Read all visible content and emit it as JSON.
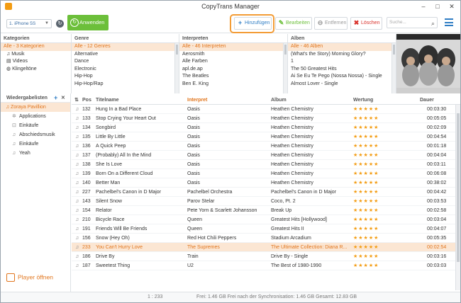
{
  "window": {
    "title": "CopyTrans Manager",
    "min": "–",
    "max": "□",
    "close": "✕"
  },
  "toolbar": {
    "device": "1. iPhone 5S",
    "refresh_icon": "↻",
    "apply_label": "Anwenden",
    "add_label": "Hinzufügen",
    "edit_label": "Bearbeiten",
    "remove_label": "Entfernen",
    "delete_label": "Löschen",
    "search_placeholder": "Suche..."
  },
  "panes": {
    "categories": {
      "header": "Kategorien",
      "items": [
        "Alle - 3 Kategorien",
        "Musik",
        "Videos",
        "Klingeltöne"
      ]
    },
    "genre": {
      "header": "Genre",
      "items": [
        "Alle - 12 Genres",
        "Alternative",
        "Dance",
        "Electronic",
        "Hip-Hop",
        "Hip-Hop/Rap"
      ]
    },
    "artist": {
      "header": "Interpreten",
      "items": [
        "Alle - 46 Interpreten",
        "Aerosmith",
        "Alle Farben",
        "apl.de.ap",
        "The Beatles",
        "Ben E. King"
      ]
    },
    "album": {
      "header": "Alben",
      "items": [
        "Alle - 46 Alben",
        "(What's the Story) Morning Glory?",
        "1",
        "The 50 Greatest Hits",
        "Ai Se Eu Te Pego (Nossa Nossa) - Single",
        "Almost Lover - Single"
      ]
    }
  },
  "playlists": {
    "header": "Wiedergabelisten",
    "add_icon": "+",
    "remove_icon": "✕",
    "items": [
      "Zoraya Pavillion",
      "Applications",
      "Einkäufe",
      "Abschiedsmusik",
      "Einkäufe",
      "Yeah"
    ]
  },
  "player_open": "Player öffnen",
  "table": {
    "columns": {
      "pos": "Pos",
      "title": "Titelname",
      "artist": "Interpret",
      "album": "Album",
      "rating": "Wertung",
      "duration": "Dauer"
    },
    "rows": [
      {
        "pos": "132",
        "title": "Hung In a Bad Place",
        "artist": "Oasis",
        "album": "Heathen Chemistry",
        "rating": "★★★★★",
        "duration": "00:03:30"
      },
      {
        "pos": "133",
        "title": "Stop Crying Your Heart Out",
        "artist": "Oasis",
        "album": "Heathen Chemistry",
        "rating": "★★★★★",
        "duration": "00:05:05"
      },
      {
        "pos": "134",
        "title": "Songbird",
        "artist": "Oasis",
        "album": "Heathen Chemistry",
        "rating": "★★★★★",
        "duration": "00:02:09"
      },
      {
        "pos": "135",
        "title": "Little By Little",
        "artist": "Oasis",
        "album": "Heathen Chemistry",
        "rating": "★★★★★",
        "duration": "00:04:54"
      },
      {
        "pos": "136",
        "title": "A Quick Peep",
        "artist": "Oasis",
        "album": "Heathen Chemistry",
        "rating": "★★★★★",
        "duration": "00:01:18"
      },
      {
        "pos": "137",
        "title": "(Probably) All In the Mind",
        "artist": "Oasis",
        "album": "Heathen Chemistry",
        "rating": "★★★★★",
        "duration": "00:04:04"
      },
      {
        "pos": "138",
        "title": "She Is Love",
        "artist": "Oasis",
        "album": "Heathen Chemistry",
        "rating": "★★★★★",
        "duration": "00:03:11"
      },
      {
        "pos": "139",
        "title": "Born On a Different Cloud",
        "artist": "Oasis",
        "album": "Heathen Chemistry",
        "rating": "★★★★★",
        "duration": "00:06:08"
      },
      {
        "pos": "140",
        "title": "Better Man",
        "artist": "Oasis",
        "album": "Heathen Chemistry",
        "rating": "★★★★★",
        "duration": "00:38:02"
      },
      {
        "pos": "227",
        "title": "Pachelbel's Canon in D Major",
        "artist": "Pachelbel Orchestra",
        "album": "Pachelbel's Canon in D Major",
        "rating": "★★★★★",
        "duration": "00:04:42"
      },
      {
        "pos": "143",
        "title": "Silent Snow",
        "artist": "Parov Stelar",
        "album": "Coco, Pt. 2",
        "rating": "★★★★★",
        "duration": "00:03:53"
      },
      {
        "pos": "154",
        "title": "Relator",
        "artist": "Pete Yorn & Scarlett Johansson",
        "album": "Break Up",
        "rating": "★★★★★",
        "duration": "00:02:58"
      },
      {
        "pos": "210",
        "title": "Bicycle Race",
        "artist": "Queen",
        "album": "Greatest Hits [Hollywood]",
        "rating": "★★★★★",
        "duration": "00:03:04"
      },
      {
        "pos": "191",
        "title": "Friends Will Be Friends",
        "artist": "Queen",
        "album": "Greatest Hits II",
        "rating": "★★★★★",
        "duration": "00:04:07"
      },
      {
        "pos": "156",
        "title": "Snow (Hey Oh)",
        "artist": "Red Hot Chili Peppers",
        "album": "Stadium Arcadium",
        "rating": "★★★★★",
        "duration": "00:05:35"
      },
      {
        "pos": "233",
        "title": "You Can't Hurry Love",
        "artist": "The Supremes",
        "album": "The Ultimate Collection: Diana R...",
        "rating": "★★★★★",
        "duration": "00:02:54"
      },
      {
        "pos": "186",
        "title": "Drive By",
        "artist": "Train",
        "album": "Drive By - Single",
        "rating": "★★★★★",
        "duration": "00:03:16"
      },
      {
        "pos": "187",
        "title": "Sweetest Thing",
        "artist": "U2",
        "album": "The Best of 1980-1990",
        "rating": "★★★★★",
        "duration": "00:03:03"
      }
    ],
    "selected_pos": "233"
  },
  "status": {
    "count": "1 : 233",
    "space": "Frei: 1.46 GB Frei nach der Synchronisation: 1.46 GB Gesamt: 12.83 GB"
  },
  "colors": {
    "accent": "#e1751c",
    "highlight": "#f39c35",
    "apply_green": "#6cbf3a",
    "add_blue": "#2f7dc4",
    "delete_red": "#d9322b",
    "star": "#f39c12"
  }
}
